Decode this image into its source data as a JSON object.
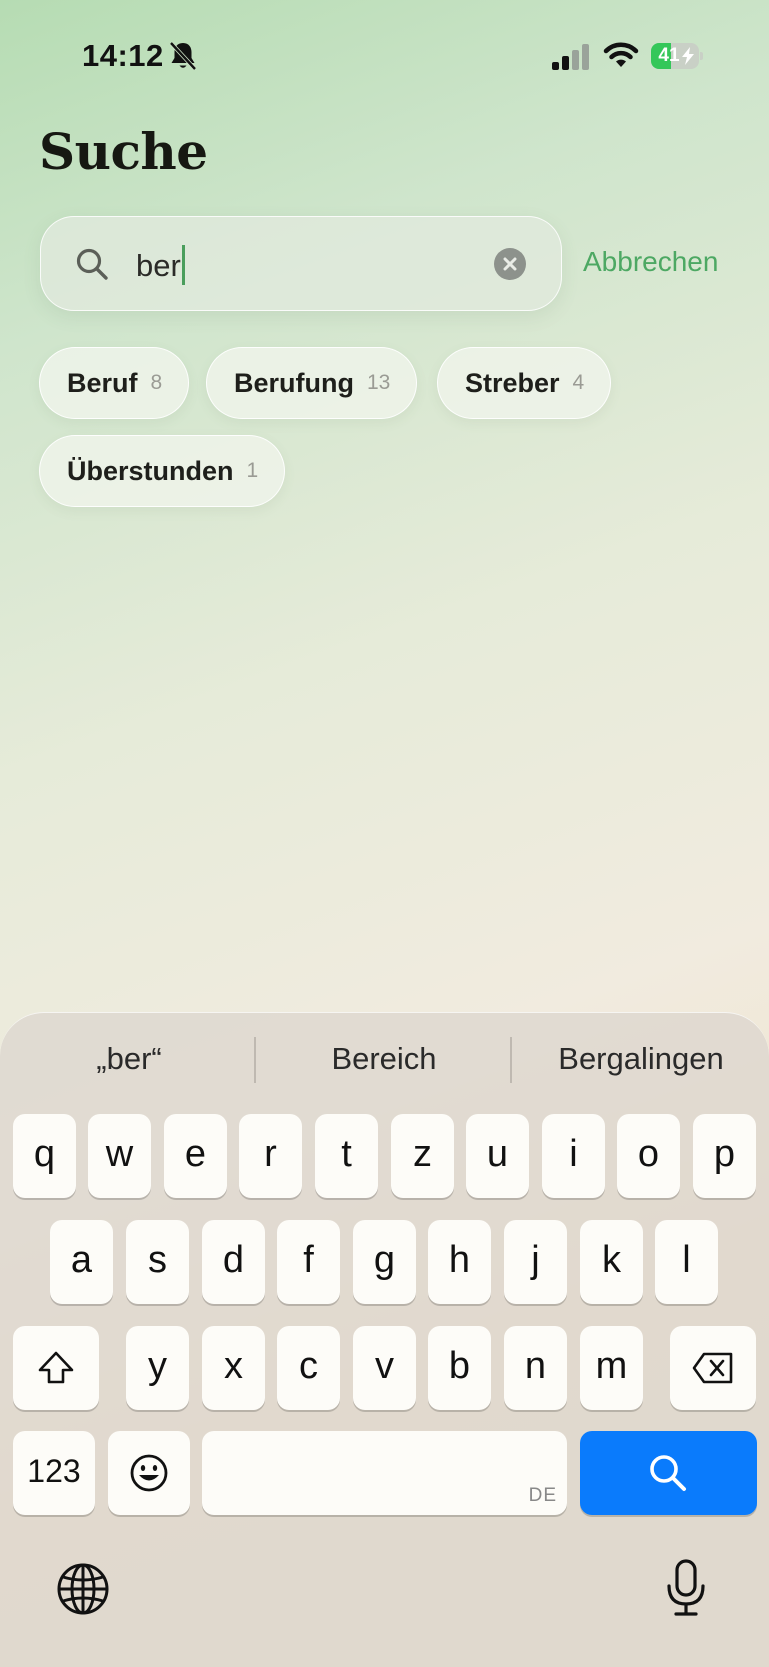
{
  "status_bar": {
    "time": "14:12",
    "battery_percent": "41",
    "battery_level": 0.41,
    "icons": [
      "bell-slash-icon",
      "signal-icon",
      "wifi-icon",
      "battery-charging-icon"
    ]
  },
  "header": {
    "title": "Suche"
  },
  "search": {
    "value": "ber",
    "cancel_label": "Abbrechen"
  },
  "chips": [
    {
      "label": "Beruf",
      "count": "8"
    },
    {
      "label": "Berufung",
      "count": "13"
    },
    {
      "label": "Streber",
      "count": "4"
    },
    {
      "label": "Überstunden",
      "count": "1"
    }
  ],
  "keyboard": {
    "suggestions": [
      "„ber“",
      "Bereich",
      "Bergalingen"
    ],
    "row1": [
      "q",
      "w",
      "e",
      "r",
      "t",
      "z",
      "u",
      "i",
      "o",
      "p"
    ],
    "row2": [
      "a",
      "s",
      "d",
      "f",
      "g",
      "h",
      "j",
      "k",
      "l"
    ],
    "row3": [
      "y",
      "x",
      "c",
      "v",
      "b",
      "n",
      "m"
    ],
    "numbers_label": "123",
    "language_label": "DE",
    "icons": [
      "shift-icon",
      "backspace-icon",
      "emoji-icon",
      "search-icon",
      "globe-icon",
      "microphone-icon"
    ]
  },
  "colors": {
    "accent_green": "#4da863",
    "search_key_blue": "#0a7bfc"
  }
}
